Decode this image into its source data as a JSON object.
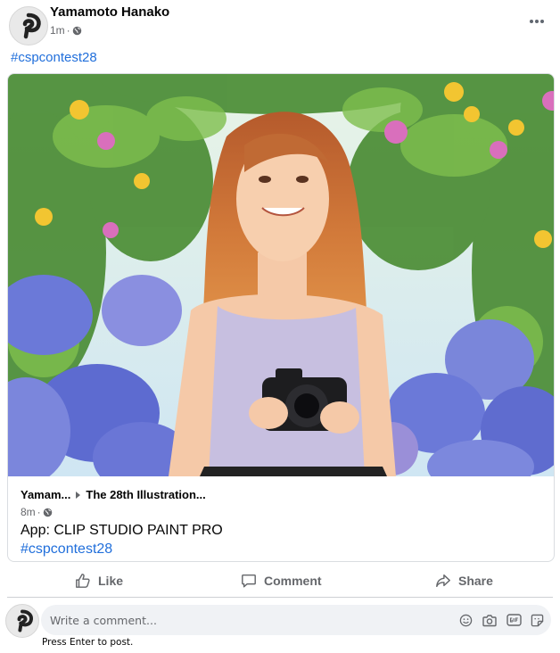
{
  "post": {
    "author_name": "Yamamoto Hanako",
    "time": "1m",
    "meta_separator": "·",
    "privacy_icon": "globe-icon",
    "more_icon": "more-horizontal-icon",
    "hashtag": "#cspcontest28"
  },
  "card": {
    "image": "illustration: smiling long-haired girl holding a camera in front of hydrangea bushes",
    "author_short": "Yamam...",
    "separator_icon": "caret-right-icon",
    "group_short": "The 28th Illustration...",
    "time": "8m",
    "meta_separator": "·",
    "text": "App: CLIP STUDIO PAINT PRO",
    "hashtag": "#cspcontest28"
  },
  "actions": [
    {
      "label": "Like",
      "icon": "thumbs-up-icon"
    },
    {
      "label": "Comment",
      "icon": "comment-icon"
    },
    {
      "label": "Share",
      "icon": "share-icon"
    }
  ],
  "comment": {
    "placeholder": "Write a comment...",
    "hint": "Press Enter to post.",
    "icons": [
      "emoji-icon",
      "camera-icon",
      "gif-icon",
      "sticker-icon"
    ]
  },
  "colors": {
    "link": "#216fdb",
    "secondary_text": "#65676b",
    "input_bg": "#f0f2f5"
  }
}
